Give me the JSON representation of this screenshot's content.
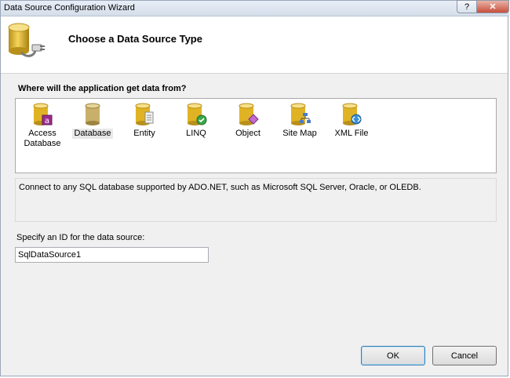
{
  "window": {
    "title": "Data Source Configuration Wizard",
    "help_label": "?",
    "close_label": "✕"
  },
  "header": {
    "title": "Choose a Data Source Type",
    "icon": "database-plug-icon"
  },
  "source_question": "Where will the application get data from?",
  "sources": [
    {
      "label": "Access Database",
      "icon": "access-database-icon"
    },
    {
      "label": "Database",
      "icon": "database-icon",
      "selected": true
    },
    {
      "label": "Entity",
      "icon": "entity-icon"
    },
    {
      "label": "LINQ",
      "icon": "linq-icon"
    },
    {
      "label": "Object",
      "icon": "object-icon"
    },
    {
      "label": "Site Map",
      "icon": "site-map-icon"
    },
    {
      "label": "XML File",
      "icon": "xml-file-icon"
    }
  ],
  "description": "Connect to any SQL database supported by ADO.NET, such as Microsoft SQL Server, Oracle, or OLEDB.",
  "id_field": {
    "label": "Specify an ID for the data source:",
    "value": "SqlDataSource1"
  },
  "buttons": {
    "ok_label": "OK",
    "cancel_label": "Cancel"
  },
  "colors": {
    "cylinder_gold": "#e0b324",
    "selection_bg": "#e8e8e8"
  }
}
